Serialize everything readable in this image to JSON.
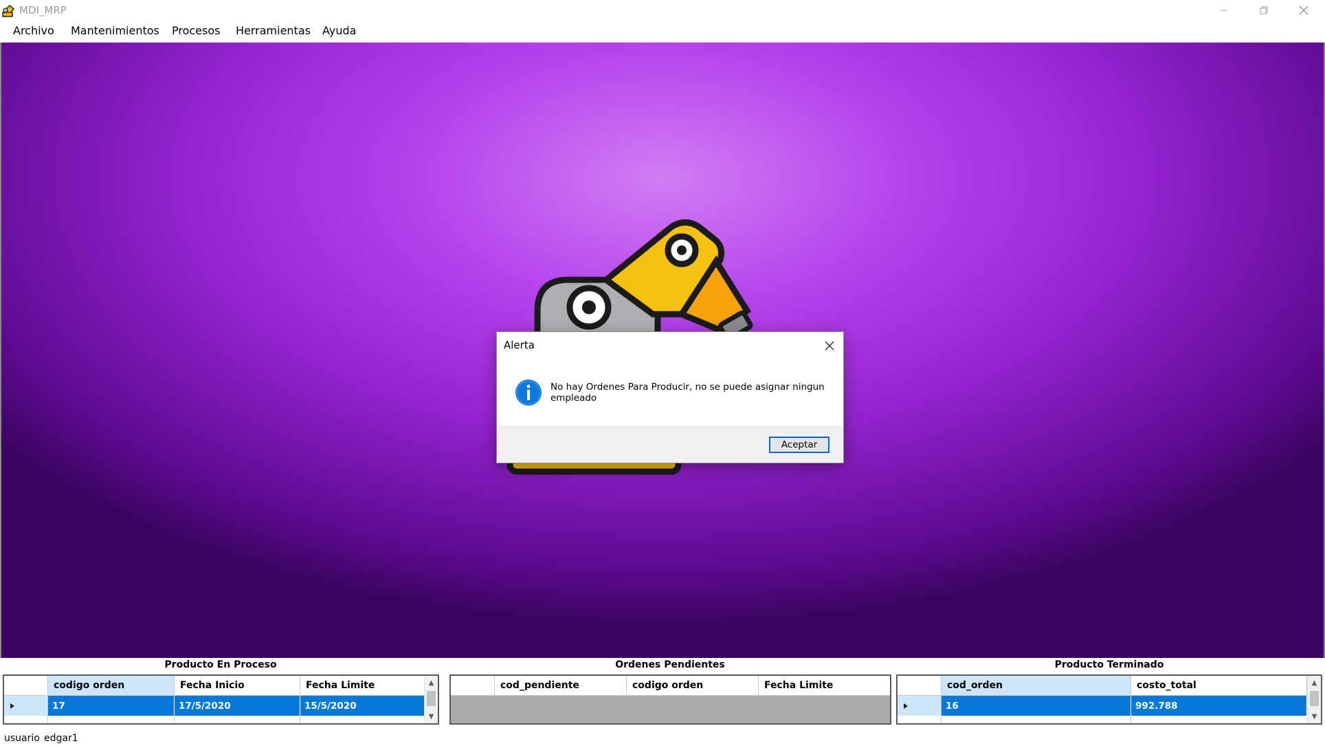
{
  "window": {
    "title": "MDI_MRP"
  },
  "menu": [
    "Archivo",
    "Mantenimientos",
    "Procesos",
    "Herramientas",
    "Ayuda"
  ],
  "dialog": {
    "title": "Alerta",
    "message": "No hay Ordenes Para Producir, no se puede asignar ningun empleado",
    "ok_label": "Aceptar",
    "icon": "info-icon"
  },
  "panels": {
    "en_proceso": {
      "title": "Producto En Proceso",
      "columns": [
        "codigo orden",
        "Fecha Inicio",
        "Fecha Limite"
      ],
      "rows": [
        [
          "17",
          "17/5/2020",
          "15/5/2020"
        ]
      ]
    },
    "pendientes": {
      "title": "Ordenes Pendientes",
      "columns": [
        "cod_pendiente",
        "codigo orden",
        "Fecha Limite"
      ],
      "rows": []
    },
    "terminado": {
      "title": "Producto Terminado",
      "columns": [
        "cod_orden",
        "costo_total"
      ],
      "rows": [
        [
          "16",
          "992.788"
        ]
      ]
    }
  },
  "status": {
    "label": "usuario",
    "value": "edgar1"
  },
  "colors": {
    "accent": "#0678d7",
    "background_purple": "#a938e3"
  }
}
